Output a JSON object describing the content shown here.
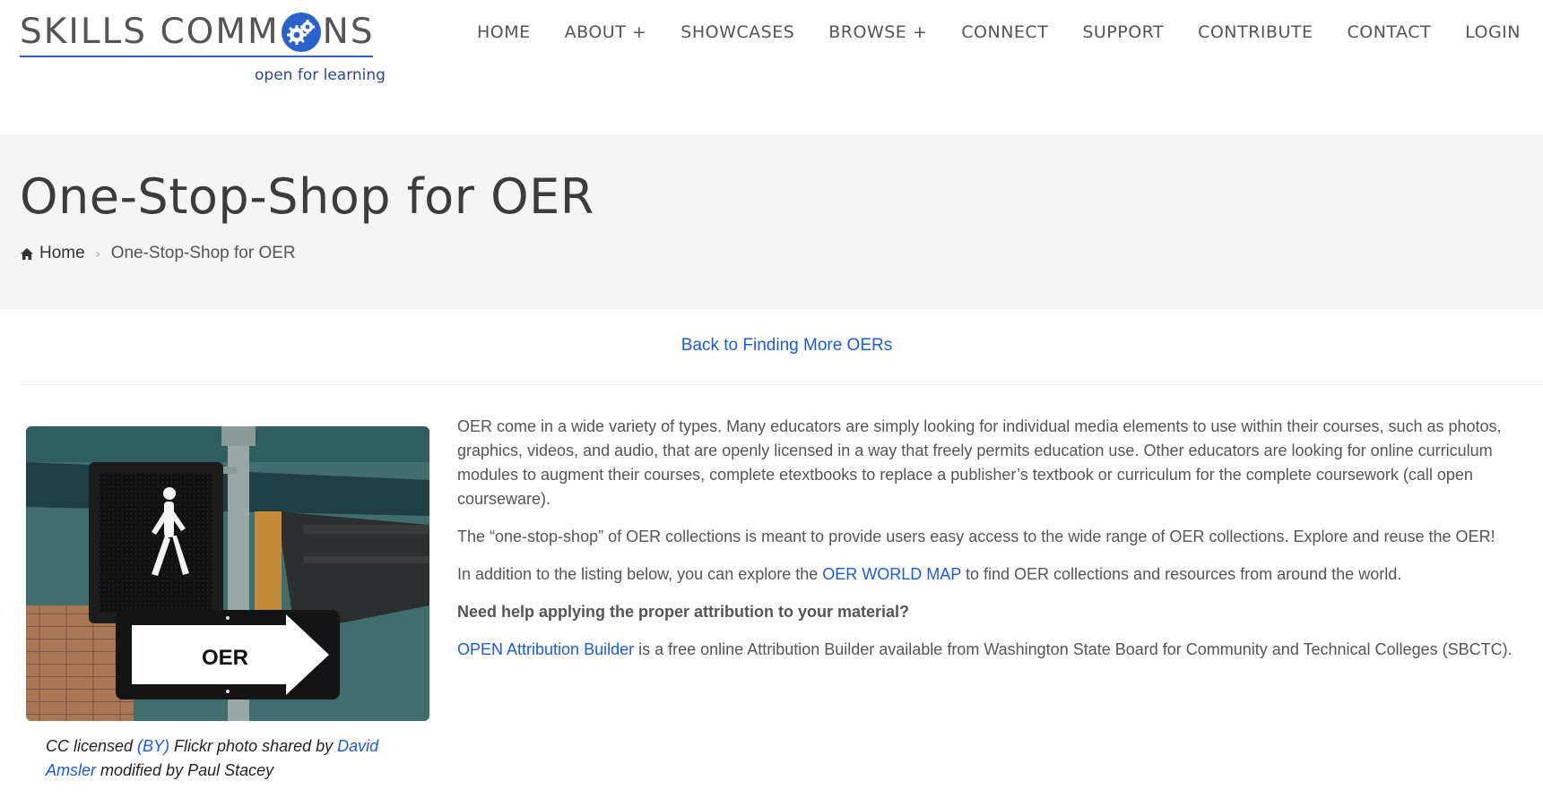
{
  "logo": {
    "word_left": "SKILLS COMM",
    "word_right": "NS",
    "tagline": "open for learning"
  },
  "nav": {
    "items": [
      "HOME",
      "ABOUT +",
      "SHOWCASES",
      "BROWSE +",
      "CONNECT",
      "SUPPORT",
      "CONTRIBUTE",
      "CONTACT",
      "LOGIN"
    ]
  },
  "page": {
    "title": "One-Stop-Shop for OER"
  },
  "breadcrumb": {
    "home": "Home",
    "separator": "›",
    "current": "One-Stop-Shop for OER"
  },
  "back_link": "Back to Finding More OERs",
  "image": {
    "sign_text": "OER"
  },
  "caption": {
    "prefix": "CC licensed ",
    "license_link": "(BY)",
    "middle": " Flickr photo shared by ",
    "author_link": "David Amsler",
    "suffix": " modified by Paul Stacey"
  },
  "content": {
    "p1": "OER come in a wide variety of types. Many educators are simply looking for individual media elements to use within their courses, such as photos, graphics, videos, and audio, that are openly licensed in a way that freely permits education use.  Other educators are looking for online curriculum modules to augment their courses, complete etextbooks to replace a publisher’s textbook or curriculum for the complete coursework (call open courseware).",
    "p2": "The “one-stop-shop” of OER collections is meant to provide users easy access to the wide range of OER collections. Explore and reuse the OER!",
    "p3_before": "In addition to the listing below, you can explore the ",
    "p3_link": "OER WORLD MAP",
    "p3_after": " to find OER collections and resources from around the world.",
    "p4": "Need help applying the proper attribution to your material?",
    "p5_link": "OPEN Attribution Builder",
    "p5_after": " is a free online Attribution Builder available from Washington State Board for Community and Technical Colleges (SBCTC)."
  },
  "colors": {
    "link": "#1e5bd6",
    "logo_blue": "#2a62c9",
    "band_bg": "#f5f5f5"
  },
  "icons": {
    "home": "home-icon",
    "gear": "gear-icon"
  }
}
